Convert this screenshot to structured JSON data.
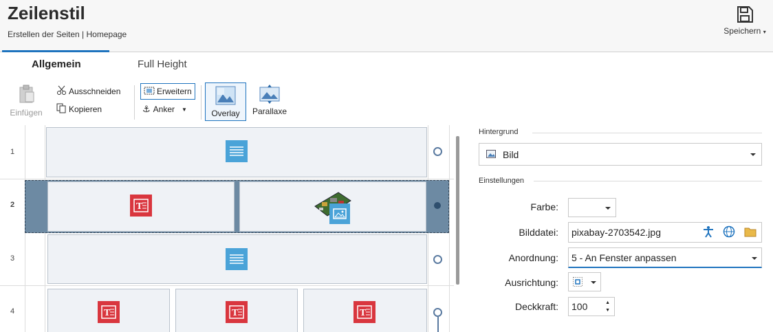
{
  "header": {
    "title": "Zeilenstil",
    "subtitle": "Erstellen der Seiten | Homepage",
    "save_label": "Speichern"
  },
  "tabs": [
    {
      "label": "Allgemein",
      "active": true
    },
    {
      "label": "Full Height",
      "active": false
    }
  ],
  "ribbon": {
    "paste_label": "Einfügen",
    "cut_label": "Ausschneiden",
    "copy_label": "Kopieren",
    "expand_label": "Erweitern",
    "anchor_label": "Anker",
    "overlay_label": "Overlay",
    "parallax_label": "Parallaxe"
  },
  "rows": [
    {
      "number": "1"
    },
    {
      "number": "2"
    },
    {
      "number": "3"
    },
    {
      "number": "4"
    }
  ],
  "panel": {
    "background_section": "Hintergrund",
    "background_value": "Bild",
    "settings_section": "Einstellungen",
    "color_label": "Farbe:",
    "image_file_label": "Bilddatei:",
    "image_file_value": "pixabay-2703542.jpg",
    "arrangement_label": "Anordnung:",
    "arrangement_value": "5 - An Fenster anpassen",
    "alignment_label": "Ausrichtung:",
    "opacity_label": "Deckkraft:",
    "opacity_value": "100"
  },
  "colors": {
    "accent": "#1e73be",
    "text_block_icon": "#4aa3d8",
    "title_block_icon": "#d9363e",
    "selected_row": "#6d8aa3"
  }
}
